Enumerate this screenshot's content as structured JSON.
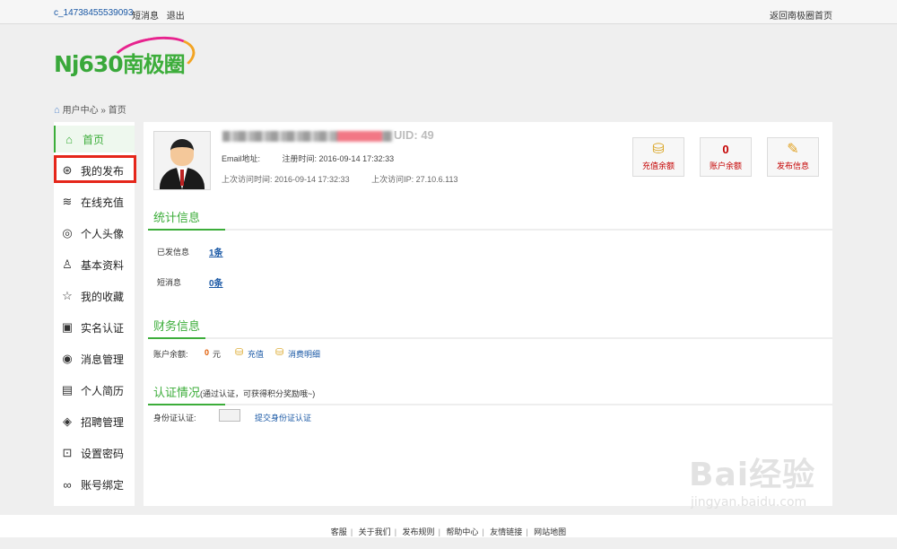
{
  "topbar": {
    "user": "c_14738455539093",
    "messages": "短消息",
    "logout": "退出",
    "home": "返回南极圈首页"
  },
  "logo": {
    "brand": "Nj630",
    "brand_cn": "南极圈"
  },
  "breadcrumb": "用户中心 » 首页",
  "sidebar": {
    "items": [
      {
        "label": "首页",
        "icon": "home-icon"
      },
      {
        "label": "我的发布",
        "icon": "publish-icon"
      },
      {
        "label": "在线充值",
        "icon": "coins-icon"
      },
      {
        "label": "个人头像",
        "icon": "avatar-icon"
      },
      {
        "label": "基本资料",
        "icon": "user-icon"
      },
      {
        "label": "我的收藏",
        "icon": "star-icon"
      },
      {
        "label": "实名认证",
        "icon": "id-card-icon"
      },
      {
        "label": "消息管理",
        "icon": "message-icon"
      },
      {
        "label": "个人简历",
        "icon": "resume-icon"
      },
      {
        "label": "招聘管理",
        "icon": "recruit-icon"
      },
      {
        "label": "设置密码",
        "icon": "lock-icon"
      },
      {
        "label": "账号绑定",
        "icon": "link-icon"
      }
    ]
  },
  "profile": {
    "uid": "UID: 49",
    "email_label": "Email地址:",
    "register_time": "注册时间: 2016-09-14 17:32:33",
    "last_visit": "上次访问时间: 2016-09-14 17:32:33",
    "last_ip": "上次访问IP: 27.10.6.113"
  },
  "actions": {
    "recharge": "充值余额",
    "balance_value": "0",
    "balance_label": "账户余额",
    "publish": "发布信息"
  },
  "stats": {
    "title": "统计信息",
    "posted_label": "已发信息",
    "posted_value": "1条",
    "msg_label": "短消息",
    "msg_value": "0条"
  },
  "finance": {
    "title": "财务信息",
    "balance_label": "账户余额:",
    "balance_value": "0",
    "unit": "元",
    "recharge": "充值",
    "detail": "消费明细"
  },
  "verify": {
    "title": "认证情况",
    "hint": "(通过认证，可获得积分奖励哦~)",
    "id_label": "身份证认证:",
    "submit": "提交身份证认证"
  },
  "footer": {
    "items": [
      "客服",
      "关于我们",
      "发布规则",
      "帮助中心",
      "友情链接",
      "网站地图"
    ]
  },
  "watermark": {
    "big": "Bai经验",
    "url": "jingyan.baidu.com"
  },
  "colors": {
    "accent": "#3cad3a",
    "link": "#1a58a5",
    "highlight": "#e5261a"
  }
}
